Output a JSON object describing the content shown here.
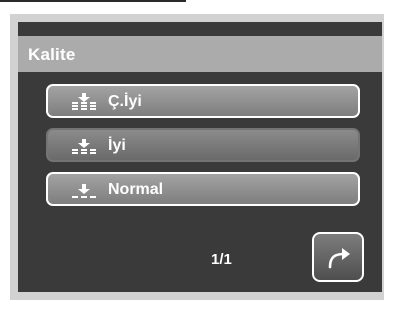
{
  "menu": {
    "title": "Kalite",
    "items": [
      {
        "label": "Ç.İyi",
        "icon": "quality-fine-icon",
        "selected": false
      },
      {
        "label": "İyi",
        "icon": "quality-standard-icon",
        "selected": true
      },
      {
        "label": "Normal",
        "icon": "quality-economy-icon",
        "selected": false
      }
    ]
  },
  "pagination": {
    "page_text": "1/1"
  },
  "controls": {
    "return_icon": "return-arrow-icon"
  },
  "colors": {
    "screen_background": "#3a3a3a",
    "title_bar": "#ababab",
    "menu_button": "#8c8c8c",
    "selected_button": "#767676",
    "text": "#ffffff"
  }
}
